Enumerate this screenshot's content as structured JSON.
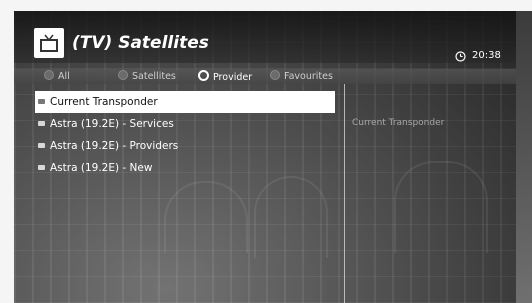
{
  "header": {
    "title": "(TV) Satellites",
    "time": "20:38",
    "icon": "tv-icon"
  },
  "tabs": [
    {
      "label": "All",
      "active": false
    },
    {
      "label": "Satellites",
      "active": false
    },
    {
      "label": "Provider",
      "active": true
    },
    {
      "label": "Favourites",
      "active": false
    }
  ],
  "list": {
    "items": [
      {
        "label": "Current Transponder",
        "selected": true
      },
      {
        "label": "Astra (19.2E) - Services",
        "selected": false
      },
      {
        "label": "Astra (19.2E) - Providers",
        "selected": false
      },
      {
        "label": "Astra (19.2E) - New",
        "selected": false
      }
    ]
  },
  "detail": {
    "text": "Current Transponder"
  },
  "colors": {
    "selection": "#ffffff",
    "text": "#ffffff"
  }
}
